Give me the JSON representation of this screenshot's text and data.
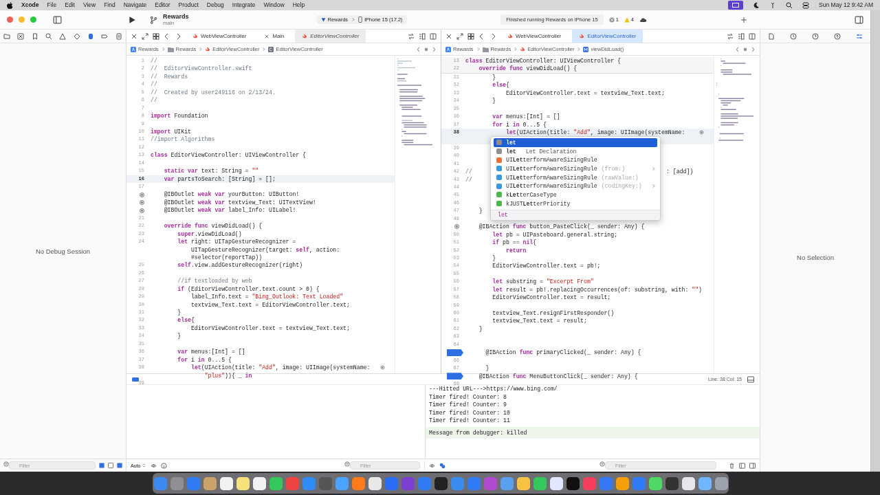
{
  "menu_bar": {
    "app": "Xcode",
    "items": [
      "File",
      "Edit",
      "View",
      "Find",
      "Navigate",
      "Editor",
      "Product",
      "Debug",
      "Integrate",
      "Window",
      "Help"
    ],
    "clock": "Sun May 12  9:42 AM"
  },
  "toolbar": {
    "project": "Rewards",
    "branch": "main",
    "scheme": "Rewards",
    "destination": "iPhone 15 (17.2)",
    "status": "Finished running Rewards on iPhone 15",
    "errors": "1",
    "warnings": "4"
  },
  "navigator": {
    "message": "No Debug Session",
    "filter_placeholder": "Filter"
  },
  "editors": [
    {
      "focused": false,
      "tabs": [
        {
          "label": "WebViewController",
          "kind": "swift",
          "selected": false
        },
        {
          "label": "Main",
          "kind": "storyboard",
          "selected": false
        },
        {
          "label": "EditorViewController",
          "kind": "swift",
          "selected": true
        }
      ],
      "breadcrumb": [
        {
          "label": "Rewards",
          "kind": "project"
        },
        {
          "label": "Rewards",
          "kind": "folder"
        },
        {
          "label": "EditorViewController",
          "kind": "swift"
        },
        {
          "label": "EditorViewController",
          "kind": "class"
        }
      ],
      "lines": [
        {
          "num": "1",
          "kind": "comment",
          "code": "//",
          "current": false
        },
        {
          "num": "2",
          "kind": "comment",
          "code": "//  EditorViewController.swift",
          "current": false
        },
        {
          "num": "3",
          "kind": "comment",
          "code": "//  Rewards",
          "current": false
        },
        {
          "num": "4",
          "kind": "comment",
          "code": "//",
          "current": false
        },
        {
          "num": "5",
          "kind": "comment",
          "code": "//  Created by user249116 on 2/13/24.",
          "current": false
        },
        {
          "num": "6",
          "kind": "comment",
          "code": "//",
          "current": false
        },
        {
          "num": "7",
          "kind": "code",
          "current": false
        },
        {
          "num": "8",
          "kind": "code",
          "code": "**import** Foundation",
          "current": false
        },
        {
          "num": "9",
          "kind": "code",
          "current": false
        },
        {
          "num": "10",
          "kind": "code",
          "code": "**import** UIKit",
          "current": false
        },
        {
          "num": "11",
          "kind": "comment",
          "code": "//import Algorithms",
          "current": false
        },
        {
          "num": "12",
          "kind": "code",
          "current": false
        },
        {
          "num": "13",
          "kind": "code",
          "code": "**class** EditorViewController: UIViewController {",
          "current": false
        },
        {
          "num": "14",
          "kind": "code",
          "current": false
        },
        {
          "num": "15",
          "kind": "code",
          "code": "    **static** **var** text: String = *\"\"*",
          "current": false
        },
        {
          "num": "16",
          "kind": "code",
          "code": "    **var** partsToSearch: [String] = [];",
          "current": true
        },
        {
          "num": "17",
          "kind": "code",
          "current": false
        },
        {
          "kind": "outlet",
          "code": "    @IBOutlet **weak** **var** yourButton: UIButton!",
          "current": false
        },
        {
          "kind": "outlet",
          "code": "    @IBOutlet **weak** **var** textview_Text: UITextView!",
          "current": false
        },
        {
          "kind": "outlet",
          "code": "    @IBOutlet **weak** **var** label_Info: UILabel!",
          "current": false
        },
        {
          "num": "21",
          "kind": "code",
          "current": false
        },
        {
          "num": "22",
          "kind": "code",
          "code": "    **override** **func** viewDidLoad() {",
          "current": false
        },
        {
          "num": "23",
          "kind": "code",
          "code": "        **super**.viewDidLoad()",
          "current": false
        },
        {
          "num": "24",
          "kind": "code",
          "code": "        **let** right: UITapGestureRecognizer =",
          "continuation": [
            "            UITapGestureRecognizer(target: **self**, action:",
            "            #selector(reportTap))"
          ],
          "current": false
        },
        {
          "num": "25",
          "kind": "code",
          "code": "        **self**.view.addGestureRecognizer(right)",
          "current": false
        },
        {
          "num": "26",
          "kind": "code",
          "current": false
        },
        {
          "num": "27",
          "kind": "comment",
          "code": "        //if textloaded by web",
          "current": false
        },
        {
          "num": "28",
          "kind": "code",
          "code": "        **if** (EditorViewController.text.count > 0) {",
          "current": false
        },
        {
          "num": "29",
          "kind": "code",
          "code": "            label_Info.text = *\"Bing_Outlook: Text Loaded\"*",
          "current": false
        },
        {
          "num": "30",
          "kind": "code",
          "code": "            textview_Text.text = EditorViewController.text;",
          "current": false
        },
        {
          "num": "31",
          "kind": "code",
          "code": "        }",
          "current": false
        },
        {
          "num": "32",
          "kind": "code",
          "code": "        **else**{",
          "current": false
        },
        {
          "num": "33",
          "kind": "code",
          "code": "            EditorViewController.text = textview_Text.text;",
          "current": false
        },
        {
          "num": "34",
          "kind": "code",
          "code": "        }",
          "current": false
        },
        {
          "num": "35",
          "kind": "code",
          "current": false
        },
        {
          "num": "36",
          "kind": "code",
          "code": "        **var** menus:[Int] = []",
          "current": false
        },
        {
          "num": "37",
          "kind": "code",
          "code": "        **for** i **in** 0...5 {",
          "current": false
        },
        {
          "num": "38",
          "kind": "code",
          "code": "            **let**(UIAction(title: *\"Add\"*, image: UIImage(systemName:",
          "continuation": [
            "                *\"plus\"*)){ _ **in**"
          ],
          "fix_it": true,
          "current": false
        },
        {
          "num": "39",
          "kind": "code",
          "current": false
        }
      ]
    },
    {
      "focused": true,
      "tabs": [
        {
          "label": "WebViewController",
          "kind": "swift",
          "selected": false
        },
        {
          "label": "EditorViewController",
          "kind": "swift",
          "selected": true
        }
      ],
      "breadcrumb": [
        {
          "label": "Rewards",
          "kind": "project"
        },
        {
          "label": "Rewards",
          "kind": "folder"
        },
        {
          "label": "EditorViewController",
          "kind": "swift"
        },
        {
          "label": "viewDidLoad()",
          "kind": "method"
        }
      ],
      "sticky_lines": [
        {
          "num": "13",
          "kind": "code",
          "code": "**class** EditorViewController: UIViewController {",
          "current": false
        },
        {
          "num": "22",
          "kind": "code",
          "code": "    **override** **func** viewDidLoad() {",
          "current": false
        }
      ],
      "lines": [
        {
          "num": "31",
          "kind": "code",
          "code": "        }",
          "current": false
        },
        {
          "num": "32",
          "kind": "code",
          "code": "        **else**{",
          "current": false
        },
        {
          "num": "33",
          "kind": "code",
          "code": "            EditorViewController.text = textview_Text.text;",
          "current": false
        },
        {
          "num": "34",
          "kind": "code",
          "code": "        }",
          "current": false
        },
        {
          "num": "35",
          "kind": "code",
          "current": false
        },
        {
          "num": "36",
          "kind": "code",
          "code": "        **var** menus:[Int] = []",
          "current": false
        },
        {
          "num": "37",
          "kind": "code",
          "code": "        **for** i **in** 0...5 {",
          "current": false
        },
        {
          "num": "38",
          "kind": "code",
          "code": "            **let**(UIAction(title: *\"Add\"*, image: UIImage(systemName:",
          "fix_it": true,
          "hidden_wrap": true,
          "current": true
        },
        {
          "num": "39",
          "kind": "code",
          "current": false
        },
        {
          "num": "40",
          "kind": "code",
          "current": false
        },
        {
          "num": "41",
          "kind": "code",
          "current": false
        },
        {
          "num": "42",
          "kind": "comment",
          "code": "//",
          "tail": ": [add])",
          "current": false
        },
        {
          "num": "43",
          "kind": "comment",
          "code": "//",
          "current": false
        },
        {
          "num": "44",
          "kind": "code",
          "current": false
        },
        {
          "num": "45",
          "kind": "code",
          "current": false
        },
        {
          "num": "46",
          "kind": "code",
          "current": false
        },
        {
          "num": "47",
          "kind": "code",
          "code": "    }",
          "current": false
        },
        {
          "num": "48",
          "kind": "code",
          "current": false
        },
        {
          "kind": "outlet",
          "code": "    @IBAction **func** button_PasteClick(_ sender: Any) {",
          "current": false
        },
        {
          "num": "50",
          "kind": "code",
          "code": "        **let** pb = UIPasteboard.general.string;",
          "current": false
        },
        {
          "num": "51",
          "kind": "code",
          "code": "        **if** pb == **nil**{",
          "current": false
        },
        {
          "num": "52",
          "kind": "code",
          "code": "            **return**",
          "current": false
        },
        {
          "num": "53",
          "kind": "code",
          "code": "        }",
          "current": false
        },
        {
          "num": "54",
          "kind": "code",
          "code": "        EditorViewController.text = pb!;",
          "current": false
        },
        {
          "num": "55",
          "kind": "code",
          "current": false
        },
        {
          "num": "56",
          "kind": "code",
          "code": "        **let** substring = *\"Excerpt From\"*",
          "current": false
        },
        {
          "num": "57",
          "kind": "code",
          "code": "        **let** result = pb!.replacingOccurrences(of: substring, with: *\"\"*)",
          "current": false
        },
        {
          "num": "58",
          "kind": "code",
          "code": "        EditorViewController.text = result;",
          "current": false
        },
        {
          "num": "59",
          "kind": "code",
          "current": false
        },
        {
          "num": "60",
          "kind": "code",
          "code": "        textview_Text.resignFirstResponder()",
          "current": false
        },
        {
          "num": "61",
          "kind": "code",
          "code": "        textview_Text.text = result;",
          "current": false
        },
        {
          "num": "62",
          "kind": "code",
          "code": "    }",
          "current": false
        },
        {
          "num": "63",
          "kind": "code",
          "current": false
        },
        {
          "num": "64",
          "kind": "code",
          "current": false
        },
        {
          "kind": "breakpoint",
          "code": "      @IBAction **func** primaryClicked(_ sender: Any) {",
          "current": false
        },
        {
          "num": "66",
          "kind": "code",
          "current": false
        },
        {
          "num": "67",
          "kind": "code",
          "code": "      }",
          "current": false
        },
        {
          "kind": "breakpoint",
          "code": "    @IBAction **func** MenuButtonClick(_ sender: Any) {",
          "current": false
        },
        {
          "num": "69",
          "kind": "code",
          "current": false
        }
      ]
    }
  ],
  "completion": {
    "items": [
      {
        "kind": "keyword",
        "label": "**let**",
        "selected": true,
        "submenu": false
      },
      {
        "kind": "keyword",
        "label": "**let**",
        "detail": "Let Declaration",
        "selected": false,
        "submenu": false
      },
      {
        "kind": "struct",
        "label": "UI**Let**terformAwareSizingRule",
        "selected": false,
        "submenu": false
      },
      {
        "kind": "init",
        "label": "UI**Let**terformAwareSizingRule",
        "params": "(from:)",
        "selected": false,
        "submenu": true
      },
      {
        "kind": "init",
        "label": "UI**Let**terformAwareSizingRule",
        "params": "(rawValue:)",
        "selected": false,
        "submenu": false
      },
      {
        "kind": "init",
        "label": "UI**Let**terformAwareSizingRule",
        "params": "(codingKey:)",
        "selected": false,
        "submenu": true
      },
      {
        "kind": "var",
        "label": "k**Let**terCaseType",
        "selected": false,
        "submenu": false
      },
      {
        "kind": "var",
        "label": "kJUST**Let**terPriority",
        "selected": false,
        "submenu": false
      }
    ],
    "footer": "let"
  },
  "debug_area": {
    "cursor_position": "Line: 38  Col: 15",
    "scope": "Auto",
    "variables_filter_placeholder": "Filter",
    "console_lines": [
      "---Hitted URL--->https://www.bing.com/",
      "Timer fired! Counter: 8",
      "Timer fired! Counter: 9",
      "Timer fired! Counter: 10",
      "Timer fired! Counter: 11"
    ],
    "console_message": "Message from debugger: killed",
    "console_filter_placeholder": "Filter"
  },
  "inspector": {
    "message": "No Selection"
  }
}
